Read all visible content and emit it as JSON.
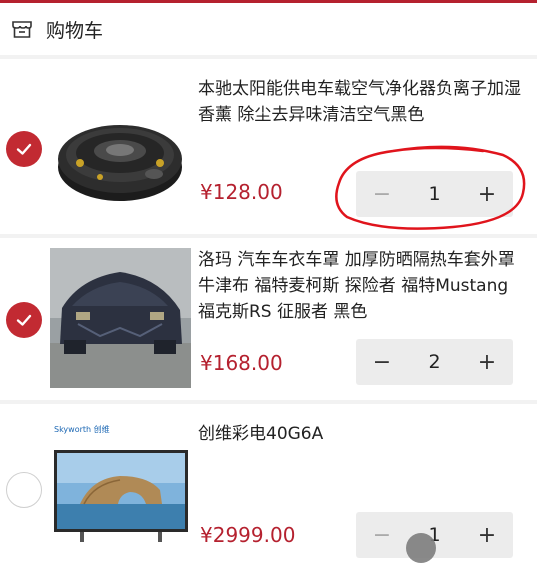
{
  "header": {
    "title": "购物车",
    "icon": "store-icon"
  },
  "colors": {
    "accent": "#b5212f",
    "checked": "#c22a32",
    "annotation": "#e0141c"
  },
  "cart": {
    "items": [
      {
        "name": "本驰太阳能供电车载空气净化器负离子加湿香薰 除尘去异味清洁空气黑色",
        "price": "¥128.00",
        "quantity": "1",
        "selected": true,
        "minus_label": "−",
        "plus_label": "+",
        "image": "air-purifier-image"
      },
      {
        "name": "洛玛 汽车车衣车罩 加厚防晒隔热车套外罩牛津布 福特麦柯斯 探险者 福特Mustang 福克斯RS 征服者 黑色",
        "price": "¥168.00",
        "quantity": "2",
        "selected": true,
        "minus_label": "−",
        "plus_label": "+",
        "image": "car-cover-image"
      },
      {
        "name": "创维彩电40G6A",
        "price": "¥2999.00",
        "quantity": "1",
        "selected": false,
        "minus_label": "−",
        "plus_label": "+",
        "brand_text": "Skyworth 创维",
        "image": "tv-image"
      }
    ]
  }
}
